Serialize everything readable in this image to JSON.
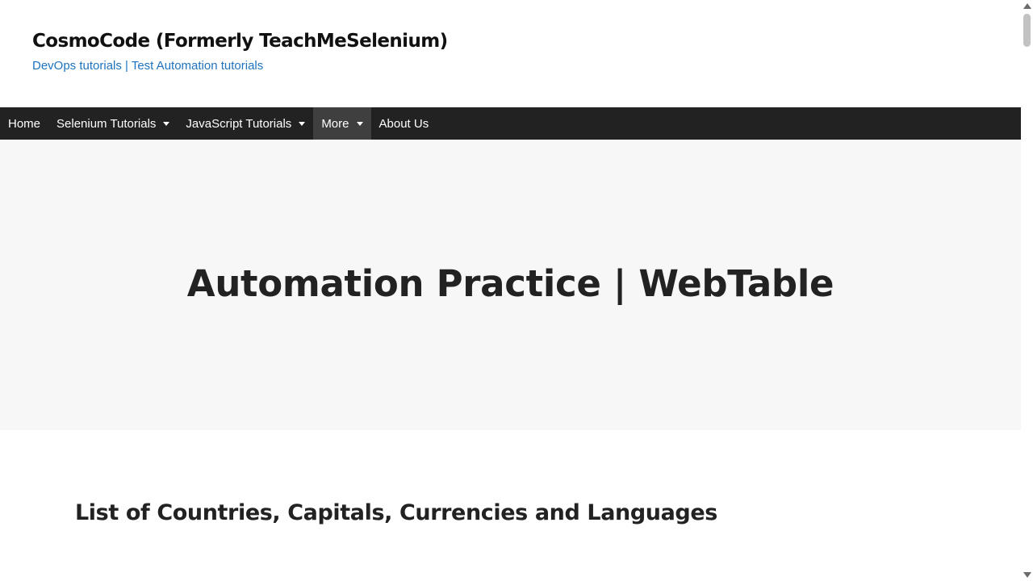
{
  "header": {
    "site_title": "CosmoCode (Formerly TeachMeSelenium)",
    "tagline": "DevOps tutorials | Test Automation tutorials"
  },
  "nav": {
    "items": [
      {
        "label": "Home",
        "has_dropdown": false,
        "active": false
      },
      {
        "label": "Selenium Tutorials",
        "has_dropdown": true,
        "active": false
      },
      {
        "label": "JavaScript Tutorials",
        "has_dropdown": true,
        "active": false
      },
      {
        "label": "More",
        "has_dropdown": true,
        "active": true
      },
      {
        "label": "About Us",
        "has_dropdown": false,
        "active": false
      }
    ]
  },
  "hero": {
    "title": "Automation Practice | WebTable"
  },
  "content": {
    "section_heading": "List of Countries, Capitals, Currencies and Languages"
  },
  "colors": {
    "nav_background": "#222222",
    "nav_active": "#3f3f3f",
    "tagline": "#1e73be",
    "hero_background": "#f7f7f7"
  },
  "icons": {
    "dropdown": "caret-down-icon",
    "scroll_up": "arrow-up-icon",
    "scroll_down": "arrow-down-icon"
  }
}
